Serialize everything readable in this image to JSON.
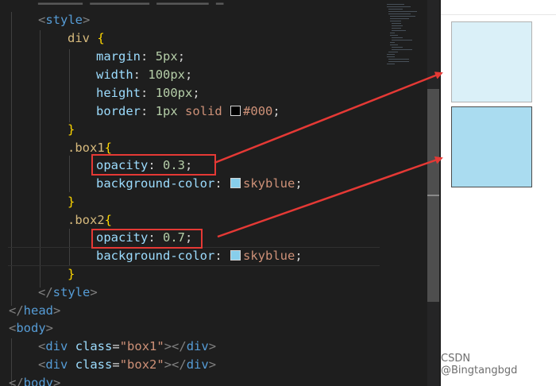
{
  "code": {
    "line_style_open": {
      "open": "<",
      "tag": "style",
      "close": ">"
    },
    "div_selector": "div",
    "brace_open": "{",
    "brace_close": "}",
    "colon": ":",
    "semicolon": ";",
    "margin": {
      "prop": "margin",
      "value": "5px"
    },
    "width": {
      "prop": "width",
      "value": "100px"
    },
    "height": {
      "prop": "height",
      "value": "100px"
    },
    "border": {
      "prop": "border",
      "num": "1px",
      "kw": "solid",
      "color": "#000"
    },
    "box1_selector": ".box1",
    "box1_opacity": {
      "prop": "opacity",
      "value": "0.3"
    },
    "box1_bg": {
      "prop": "background-color",
      "value": "skyblue"
    },
    "box2_selector": ".box2",
    "box2_opacity": {
      "prop": "opacity",
      "value": "0.7"
    },
    "box2_bg": {
      "prop": "background-color",
      "value": "skyblue"
    },
    "style_close": {
      "open": "</",
      "tag": "style",
      "close": ">"
    },
    "head_close": {
      "open": "</",
      "tag": "head",
      "close": ">"
    },
    "body_open": {
      "open": "<",
      "tag": "body",
      "close": ">"
    },
    "div1": {
      "tag": "div",
      "attr": "class",
      "eq": "=",
      "value": "\"box1\"",
      "end_tag": "div"
    },
    "div2": {
      "tag": "div",
      "attr": "class",
      "eq": "=",
      "value": "\"box2\"",
      "end_tag": "div"
    },
    "body_close": {
      "open": "</",
      "tag": "body",
      "close": ">"
    }
  },
  "colors": {
    "swatch_black": "#000000",
    "swatch_skyblue": "#87ceeb",
    "annotation_red": "#e53935"
  },
  "preview": {
    "box1_opacity": 0.3,
    "box2_opacity": 0.7,
    "box_color": "#87ceeb"
  },
  "watermark": "CSDN @Bingtangbgd"
}
